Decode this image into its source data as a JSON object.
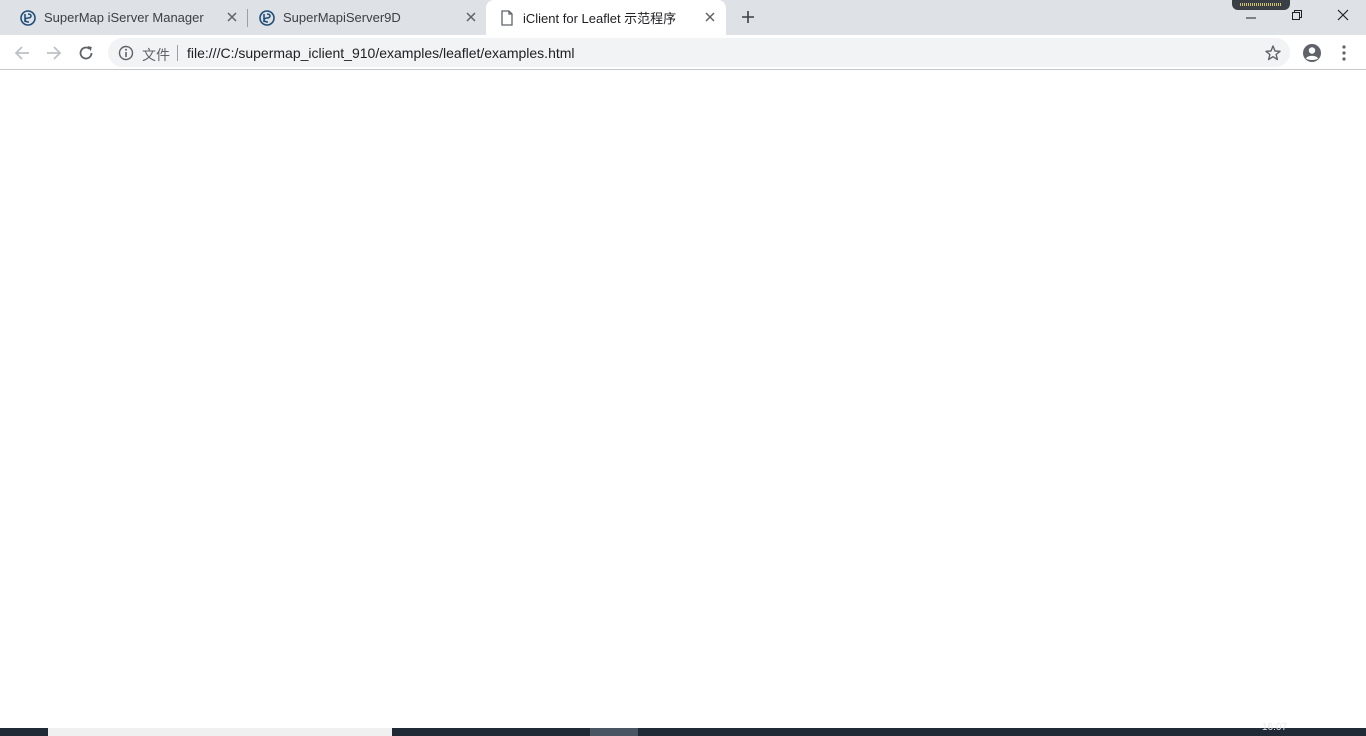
{
  "tabs": [
    {
      "title": "SuperMap iServer Manager",
      "icon": "supermap-logo-icon",
      "active": false
    },
    {
      "title": "SuperMapiServer9D",
      "icon": "supermap-logo-icon",
      "active": false
    },
    {
      "title": "iClient for Leaflet 示范程序",
      "icon": "document-icon",
      "active": true
    }
  ],
  "omnibox": {
    "security_chip": "文件",
    "url": "file:///C:/supermap_iclient_910/examples/leaflet/examples.html"
  },
  "taskbar": {
    "clock": "16:07"
  },
  "colors": {
    "tabstrip": "#dee1e6",
    "omnibox": "#f1f3f4",
    "taskbar": "#1f2a36",
    "logo": "#1f4e79"
  }
}
